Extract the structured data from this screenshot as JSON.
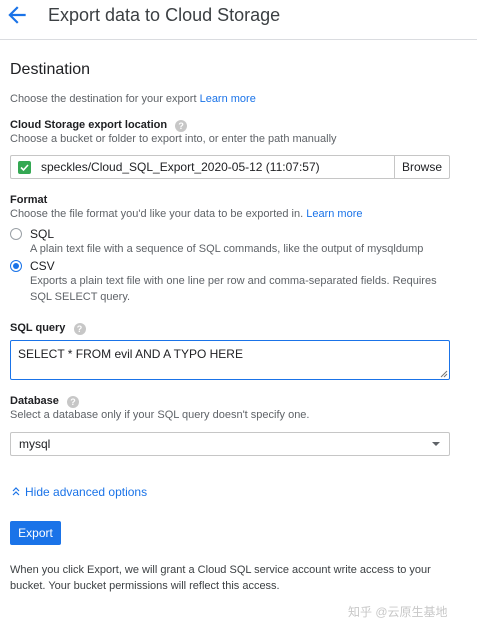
{
  "header": {
    "title": "Export data to Cloud Storage",
    "back_icon": "arrow-left-icon"
  },
  "destination": {
    "title": "Destination",
    "helper": "Choose the destination for your export",
    "learn_more": "Learn more"
  },
  "location": {
    "label": "Cloud Storage export location",
    "helper": "Choose a bucket or folder to export into, or enter the path manually",
    "value": "speckles/Cloud_SQL_Export_2020-05-12 (11:07:57)",
    "browse": "Browse",
    "valid_color": "#34a853"
  },
  "format": {
    "label": "Format",
    "helper": "Choose the file format you'd like your data to be exported in.",
    "learn_more": "Learn more",
    "options": [
      {
        "label": "SQL",
        "description": "A plain text file with a sequence of SQL commands, like the output of mysqldump",
        "selected": false
      },
      {
        "label": "CSV",
        "description_line1": "Exports a plain text file with one line per row and comma-separated fields. Requires",
        "description_line2": "SQL SELECT query.",
        "selected": true
      }
    ]
  },
  "sql_query": {
    "label": "SQL query",
    "value": "SELECT * FROM evil AND A TYPO HERE"
  },
  "database": {
    "label": "Database",
    "helper": "Select a database only if your SQL query doesn't specify one.",
    "selected": "mysql"
  },
  "advanced": {
    "label": "Hide advanced options"
  },
  "actions": {
    "export": "Export"
  },
  "footer": {
    "line1": "When you click Export, we will grant a Cloud SQL service account write access to your",
    "line2": "bucket. Your bucket permissions will reflect this access."
  },
  "watermark": "知乎 @云原生基地",
  "colors": {
    "accent": "#1a73e8",
    "text": "#202124",
    "muted": "#5f6368"
  }
}
